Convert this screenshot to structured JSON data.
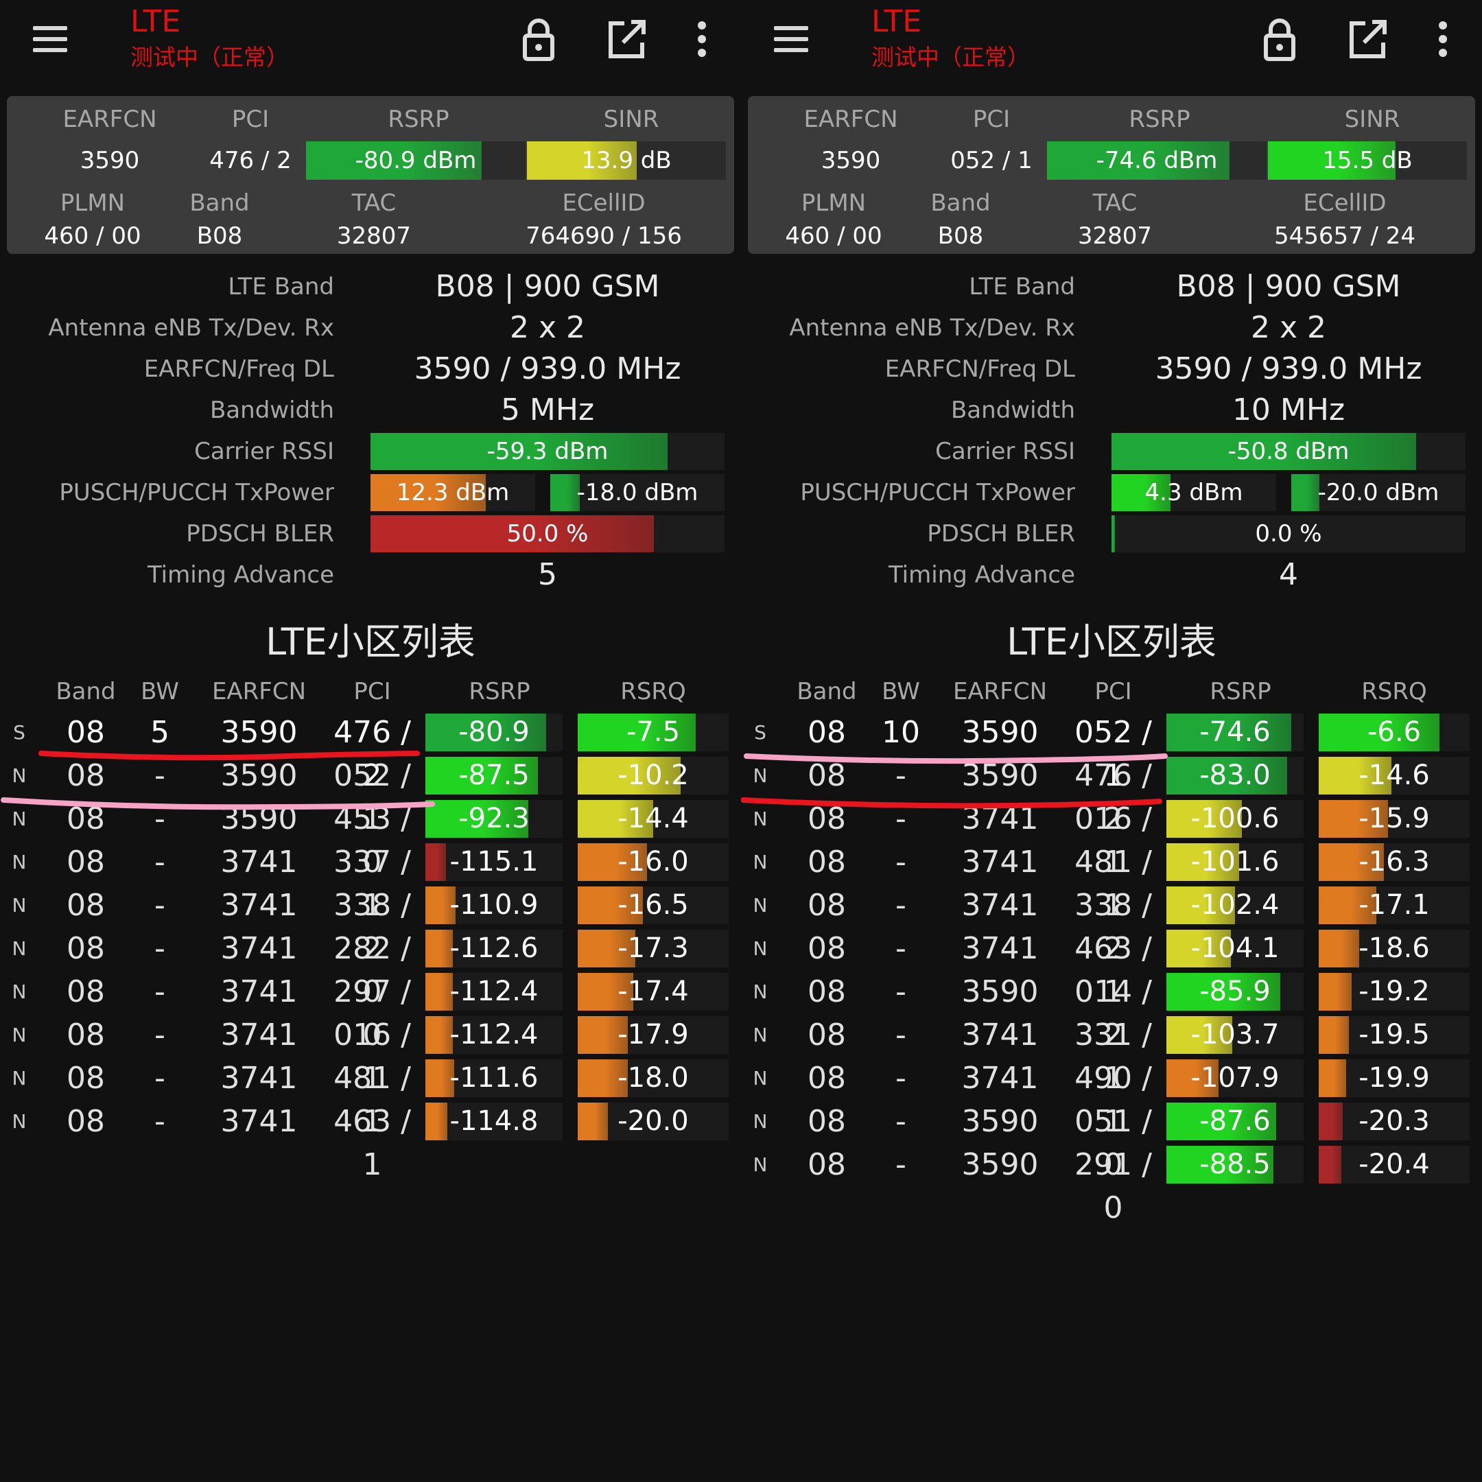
{
  "panels": [
    {
      "toolbar": {
        "title": "LTE",
        "status": "测试中（正常）",
        "icons": [
          "menu-icon",
          "lock-icon",
          "open-external-icon",
          "more-vert-icon"
        ]
      },
      "summary": {
        "headers": {
          "earfcn": "EARFCN",
          "pci": "PCI",
          "rsrp": "RSRP",
          "sinr": "SINR",
          "plmn": "PLMN",
          "band": "Band",
          "tac": "TAC",
          "ecellid": "ECellID"
        },
        "earfcn": "3590",
        "pci": "476 / 2",
        "rsrp": {
          "text": "-80.9 dBm",
          "level": 0.8,
          "color": "#1fa838"
        },
        "sinr": {
          "text": "13.9 dB",
          "level": 0.55,
          "color": "#d4d42a"
        },
        "plmn": "460 / 00",
        "band": "B08",
        "tac": "32807",
        "ecellid": "764690 / 156"
      },
      "details": {
        "lte_band": {
          "label": "LTE Band",
          "value": "B08 | 900 GSM"
        },
        "antenna": {
          "label": "Antenna eNB Tx/Dev. Rx",
          "value": "2 x 2"
        },
        "earfcn_freq": {
          "label": "EARFCN/Freq DL",
          "value": "3590 / 939.0 MHz"
        },
        "bandwidth": {
          "label": "Bandwidth",
          "value": "5 MHz"
        },
        "rssi": {
          "label": "Carrier RSSI",
          "text": "-59.3 dBm",
          "level": 0.84,
          "color": "#1fa838"
        },
        "txpower": {
          "label": "PUSCH/PUCCH TxPower",
          "pusch": {
            "text": "12.3 dBm",
            "level": 0.7,
            "color": "#e07a20"
          },
          "pucch": {
            "text": "-18.0 dBm",
            "level": 0.17,
            "color": "#1fa838"
          }
        },
        "bler": {
          "label": "PDSCH BLER",
          "text": "50.0 %",
          "level": 0.8,
          "color": "#b82828"
        },
        "ta": {
          "label": "Timing Advance",
          "value": "5"
        }
      },
      "cell_list": {
        "title": "LTE小区列表",
        "headers": {
          "band": "Band",
          "bw": "BW",
          "earfcn": "EARFCN",
          "pci": "PCI",
          "rsrp": "RSRP",
          "rsrq": "RSRQ"
        },
        "rows": [
          {
            "type": "S",
            "band": "08",
            "bw": "5",
            "earfcn": "3590",
            "pci": "476 / 2",
            "rsrp": "-80.9",
            "rsrp_level": 0.88,
            "rsrp_color": "#1fa838",
            "rsrq": "-7.5",
            "rsrq_level": 0.78,
            "rsrq_color": "#22d422"
          },
          {
            "type": "N",
            "band": "08",
            "bw": "-",
            "earfcn": "3590",
            "pci": "052 / 1",
            "rsrp": "-87.5",
            "rsrp_level": 0.82,
            "rsrp_color": "#22d422",
            "rsrq": "-10.2",
            "rsrq_level": 0.68,
            "rsrq_color": "#d4d42a"
          },
          {
            "type": "N",
            "band": "08",
            "bw": "-",
            "earfcn": "3590",
            "pci": "453 / 0",
            "rsrp": "-92.3",
            "rsrp_level": 0.75,
            "rsrp_color": "#22d422",
            "rsrq": "-14.4",
            "rsrq_level": 0.5,
            "rsrq_color": "#d4d42a"
          },
          {
            "type": "N",
            "band": "08",
            "bw": "-",
            "earfcn": "3741",
            "pci": "337 / 1",
            "rsrp": "-115.1",
            "rsrp_level": 0.15,
            "rsrp_color": "#a82828",
            "rsrq": "-16.0",
            "rsrq_level": 0.46,
            "rsrq_color": "#e07a20"
          },
          {
            "type": "N",
            "band": "08",
            "bw": "-",
            "earfcn": "3741",
            "pci": "338 / 2",
            "rsrp": "-110.9",
            "rsrp_level": 0.22,
            "rsrp_color": "#e07a20",
            "rsrq": "-16.5",
            "rsrq_level": 0.43,
            "rsrq_color": "#e07a20"
          },
          {
            "type": "N",
            "band": "08",
            "bw": "-",
            "earfcn": "3741",
            "pci": "282 / 0",
            "rsrp": "-112.6",
            "rsrp_level": 0.2,
            "rsrp_color": "#e07a20",
            "rsrq": "-17.3",
            "rsrq_level": 0.38,
            "rsrq_color": "#e07a20"
          },
          {
            "type": "N",
            "band": "08",
            "bw": "-",
            "earfcn": "3741",
            "pci": "297 / 0",
            "rsrp": "-112.4",
            "rsrp_level": 0.2,
            "rsrp_color": "#e07a20",
            "rsrq": "-17.4",
            "rsrq_level": 0.37,
            "rsrq_color": "#e07a20"
          },
          {
            "type": "N",
            "band": "08",
            "bw": "-",
            "earfcn": "3741",
            "pci": "016 / 1",
            "rsrp": "-112.4",
            "rsrp_level": 0.2,
            "rsrp_color": "#e07a20",
            "rsrq": "-17.9",
            "rsrq_level": 0.33,
            "rsrq_color": "#e07a20"
          },
          {
            "type": "N",
            "band": "08",
            "bw": "-",
            "earfcn": "3741",
            "pci": "481 / 1",
            "rsrp": "-111.6",
            "rsrp_level": 0.21,
            "rsrp_color": "#e07a20",
            "rsrq": "-18.0",
            "rsrq_level": 0.33,
            "rsrq_color": "#e07a20"
          },
          {
            "type": "N",
            "band": "08",
            "bw": "-",
            "earfcn": "3741",
            "pci": "463 / 1",
            "rsrp": "-114.8",
            "rsrp_level": 0.16,
            "rsrp_color": "#e07a20",
            "rsrq": "-20.0",
            "rsrq_level": 0.2,
            "rsrq_color": "#e07a20"
          }
        ]
      }
    },
    {
      "toolbar": {
        "title": "LTE",
        "status": "测试中（正常）",
        "icons": [
          "menu-icon",
          "lock-icon",
          "open-external-icon",
          "more-vert-icon"
        ]
      },
      "summary": {
        "headers": {
          "earfcn": "EARFCN",
          "pci": "PCI",
          "rsrp": "RSRP",
          "sinr": "SINR",
          "plmn": "PLMN",
          "band": "Band",
          "tac": "TAC",
          "ecellid": "ECellID"
        },
        "earfcn": "3590",
        "pci": "052 / 1",
        "rsrp": {
          "text": "-74.6 dBm",
          "level": 0.83,
          "color": "#1fa838"
        },
        "sinr": {
          "text": "15.5 dB",
          "level": 0.64,
          "color": "#22d422"
        },
        "plmn": "460 / 00",
        "band": "B08",
        "tac": "32807",
        "ecellid": "545657 / 24"
      },
      "details": {
        "lte_band": {
          "label": "LTE Band",
          "value": "B08 | 900 GSM"
        },
        "antenna": {
          "label": "Antenna eNB Tx/Dev. Rx",
          "value": "2 x 2"
        },
        "earfcn_freq": {
          "label": "EARFCN/Freq DL",
          "value": "3590 / 939.0 MHz"
        },
        "bandwidth": {
          "label": "Bandwidth",
          "value": "10 MHz"
        },
        "rssi": {
          "label": "Carrier RSSI",
          "text": "-50.8 dBm",
          "level": 0.86,
          "color": "#1fa838"
        },
        "txpower": {
          "label": "PUSCH/PUCCH TxPower",
          "pusch": {
            "text": "4.3 dBm",
            "level": 0.36,
            "color": "#22d422"
          },
          "pucch": {
            "text": "-20.0 dBm",
            "level": 0.16,
            "color": "#1fa838"
          }
        },
        "bler": {
          "label": "PDSCH BLER",
          "text": "0.0 %",
          "level": 0.01,
          "color": "#1fa838"
        },
        "ta": {
          "label": "Timing Advance",
          "value": "4"
        }
      },
      "cell_list": {
        "title": "LTE小区列表",
        "headers": {
          "band": "Band",
          "bw": "BW",
          "earfcn": "EARFCN",
          "pci": "PCI",
          "rsrp": "RSRP",
          "rsrq": "RSRQ"
        },
        "rows": [
          {
            "type": "S",
            "band": "08",
            "bw": "10",
            "earfcn": "3590",
            "pci": "052 / 1",
            "rsrp": "-74.6",
            "rsrp_level": 0.91,
            "rsrp_color": "#1fa838",
            "rsrq": "-6.6",
            "rsrq_level": 0.8,
            "rsrq_color": "#22d422"
          },
          {
            "type": "N",
            "band": "08",
            "bw": "-",
            "earfcn": "3590",
            "pci": "476 / 2",
            "rsrp": "-83.0",
            "rsrp_level": 0.88,
            "rsrp_color": "#1fa838",
            "rsrq": "-14.6",
            "rsrq_level": 0.48,
            "rsrq_color": "#d4d42a"
          },
          {
            "type": "N",
            "band": "08",
            "bw": "-",
            "earfcn": "3741",
            "pci": "016 / 1",
            "rsrp": "-100.6",
            "rsrp_level": 0.55,
            "rsrp_color": "#d4d42a",
            "rsrq": "-15.9",
            "rsrq_level": 0.46,
            "rsrq_color": "#e07a20"
          },
          {
            "type": "N",
            "band": "08",
            "bw": "-",
            "earfcn": "3741",
            "pci": "481 / 1",
            "rsrp": "-101.6",
            "rsrp_level": 0.53,
            "rsrp_color": "#d4d42a",
            "rsrq": "-16.3",
            "rsrq_level": 0.43,
            "rsrq_color": "#e07a20"
          },
          {
            "type": "N",
            "band": "08",
            "bw": "-",
            "earfcn": "3741",
            "pci": "338 / 2",
            "rsrp": "-102.4",
            "rsrp_level": 0.5,
            "rsrp_color": "#d4d42a",
            "rsrq": "-17.1",
            "rsrq_level": 0.38,
            "rsrq_color": "#e07a20"
          },
          {
            "type": "N",
            "band": "08",
            "bw": "-",
            "earfcn": "3741",
            "pci": "463 / 1",
            "rsrp": "-104.1",
            "rsrp_level": 0.47,
            "rsrp_color": "#d4d42a",
            "rsrq": "-18.6",
            "rsrq_level": 0.27,
            "rsrq_color": "#e07a20"
          },
          {
            "type": "N",
            "band": "08",
            "bw": "-",
            "earfcn": "3590",
            "pci": "014 / 2",
            "rsrp": "-85.9",
            "rsrp_level": 0.83,
            "rsrp_color": "#22d422",
            "rsrq": "-19.2",
            "rsrq_level": 0.22,
            "rsrq_color": "#e07a20"
          },
          {
            "type": "N",
            "band": "08",
            "bw": "-",
            "earfcn": "3741",
            "pci": "331 / 1",
            "rsrp": "-103.7",
            "rsrp_level": 0.48,
            "rsrp_color": "#d4d42a",
            "rsrq": "-19.5",
            "rsrq_level": 0.2,
            "rsrq_color": "#e07a20"
          },
          {
            "type": "N",
            "band": "08",
            "bw": "-",
            "earfcn": "3741",
            "pci": "490 / 1",
            "rsrp": "-107.9",
            "rsrp_level": 0.38,
            "rsrp_color": "#e07a20",
            "rsrq": "-19.9",
            "rsrq_level": 0.18,
            "rsrq_color": "#e07a20"
          },
          {
            "type": "N",
            "band": "08",
            "bw": "-",
            "earfcn": "3590",
            "pci": "051 / 0",
            "rsrp": "-87.6",
            "rsrp_level": 0.8,
            "rsrp_color": "#22d422",
            "rsrq": "-20.3",
            "rsrq_level": 0.16,
            "rsrq_color": "#a82828"
          },
          {
            "type": "N",
            "band": "08",
            "bw": "-",
            "earfcn": "3590",
            "pci": "291 / 0",
            "rsrp": "-88.5",
            "rsrp_level": 0.78,
            "rsrp_color": "#22d422",
            "rsrq": "-20.4",
            "rsrq_level": 0.15,
            "rsrq_color": "#a82828"
          }
        ]
      }
    }
  ],
  "annotations": {
    "serving_underline_color": "#e8141e",
    "neighbor_underline_color": "#f7a3c6"
  }
}
